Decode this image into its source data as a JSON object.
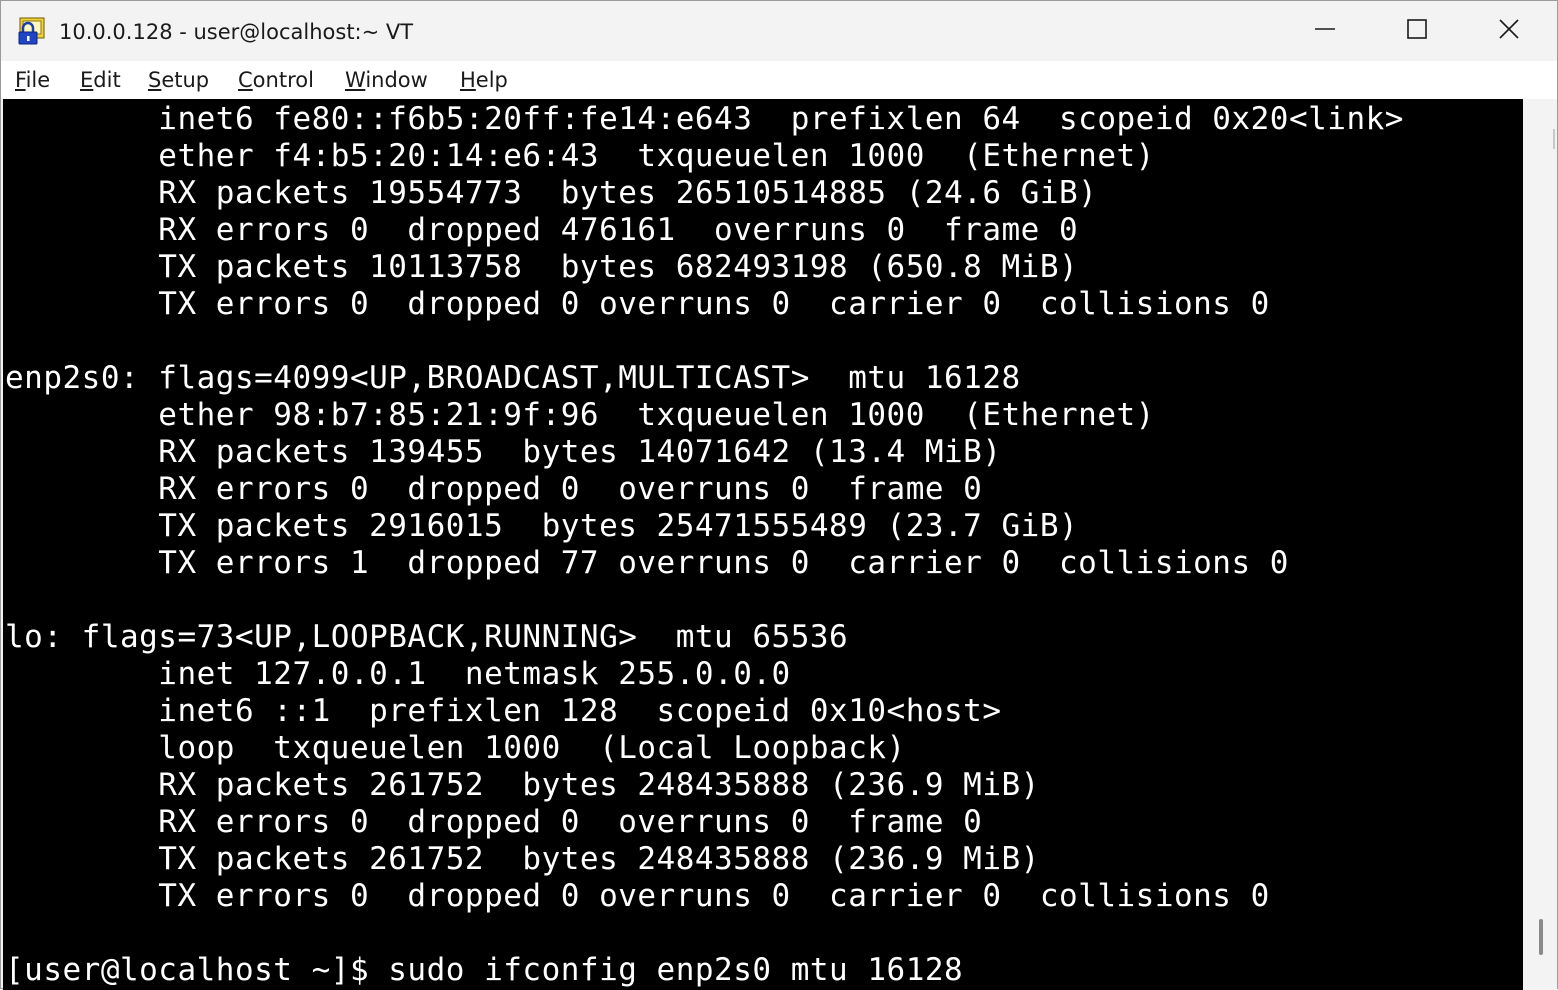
{
  "window": {
    "title": "10.0.0.128 - user@localhost:~ VT",
    "icon": "lock-terminal-icon",
    "controls": {
      "minimize": "minimize-icon",
      "maximize": "maximize-icon",
      "close": "close-icon"
    }
  },
  "menu": {
    "items": [
      {
        "access": "F",
        "rest": "ile"
      },
      {
        "access": "E",
        "rest": "dit"
      },
      {
        "access": "S",
        "rest": "etup"
      },
      {
        "access": "C",
        "rest": "ontrol"
      },
      {
        "access": "W",
        "rest": "indow"
      },
      {
        "access": "H",
        "rest": "elp"
      }
    ]
  },
  "terminal": {
    "lines": [
      "        inet6 fe80::f6b5:20ff:fe14:e643  prefixlen 64  scopeid 0x20<link>",
      "        ether f4:b5:20:14:e6:43  txqueuelen 1000  (Ethernet)",
      "        RX packets 19554773  bytes 26510514885 (24.6 GiB)",
      "        RX errors 0  dropped 476161  overruns 0  frame 0",
      "        TX packets 10113758  bytes 682493198 (650.8 MiB)",
      "        TX errors 0  dropped 0 overruns 0  carrier 0  collisions 0",
      "",
      "enp2s0: flags=4099<UP,BROADCAST,MULTICAST>  mtu 16128",
      "        ether 98:b7:85:21:9f:96  txqueuelen 1000  (Ethernet)",
      "        RX packets 139455  bytes 14071642 (13.4 MiB)",
      "        RX errors 0  dropped 0  overruns 0  frame 0",
      "        TX packets 2916015  bytes 25471555489 (23.7 GiB)",
      "        TX errors 1  dropped 77 overruns 0  carrier 0  collisions 0",
      "",
      "lo: flags=73<UP,LOOPBACK,RUNNING>  mtu 65536",
      "        inet 127.0.0.1  netmask 255.0.0.0",
      "        inet6 ::1  prefixlen 128  scopeid 0x10<host>",
      "        loop  txqueuelen 1000  (Local Loopback)",
      "        RX packets 261752  bytes 248435888 (236.9 MiB)",
      "        RX errors 0  dropped 0  overruns 0  frame 0",
      "        TX packets 261752  bytes 248435888 (236.9 MiB)",
      "        TX errors 0  dropped 0 overruns 0  carrier 0  collisions 0",
      "",
      "[user@localhost ~]$ sudo ifconfig enp2s0 mtu 16128"
    ]
  },
  "colors": {
    "terminal_bg": "#000000",
    "terminal_fg": "#ffffff",
    "chrome_bg": "#f3f3f3"
  }
}
